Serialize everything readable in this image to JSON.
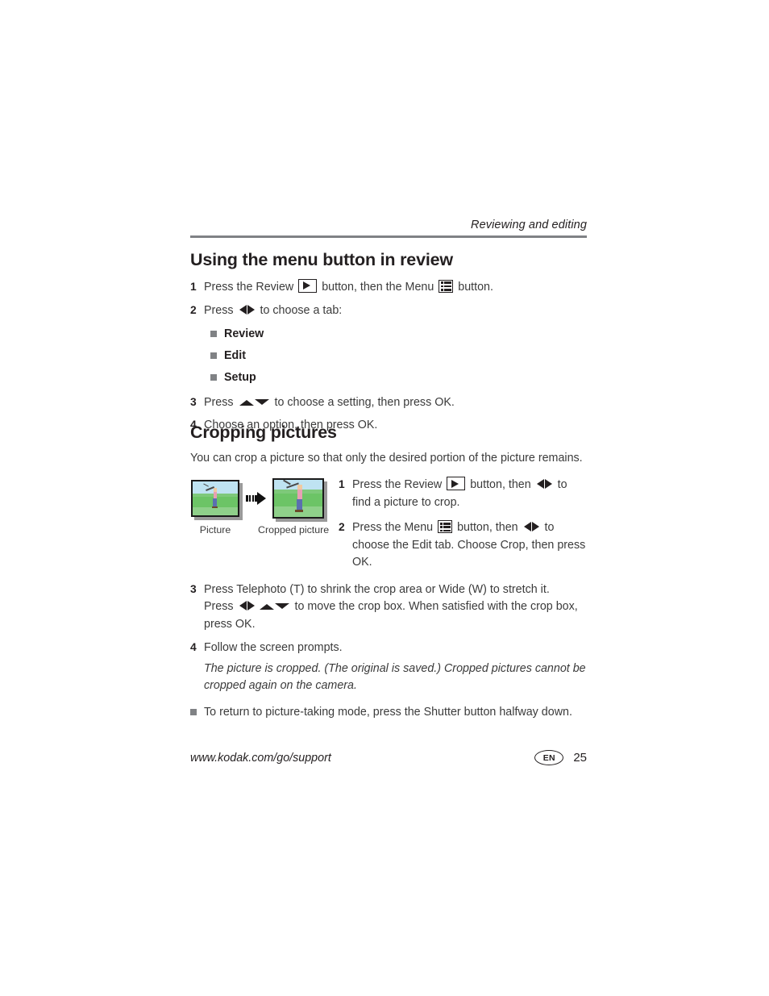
{
  "header": {
    "title": "Reviewing and editing"
  },
  "sections": [
    {
      "heading": "Using the menu button in review",
      "steps": [
        {
          "num": "1",
          "parts": [
            "Press the Review ",
            "review-icon",
            " button, then the Menu ",
            "menu-icon",
            " button."
          ]
        },
        {
          "num": "2",
          "parts": [
            "Press ",
            "left-right-arrows",
            " to choose a tab:"
          ]
        },
        {
          "num": "3",
          "parts": [
            "Press ",
            "up-down-arrows",
            " to choose a setting, then press OK."
          ]
        },
        {
          "num": "4",
          "parts": [
            "Choose an option, then press OK."
          ]
        }
      ],
      "tabs": [
        "Review",
        "Edit",
        "Setup"
      ]
    },
    {
      "heading": "Cropping pictures",
      "intro": "You can crop a picture so that only the desired portion of the picture remains.",
      "figure": {
        "caption_left": "Picture",
        "caption_right": "Cropped picture",
        "arrow": "right-block-arrow"
      },
      "steps": [
        {
          "num": "1",
          "parts": [
            "Press the Review ",
            "review-icon",
            " button, then ",
            "left-right-arrows",
            " to find a picture to crop."
          ]
        },
        {
          "num": "2",
          "parts": [
            "Press the Menu ",
            "menu-icon",
            " button, then ",
            "left-right-arrows",
            " to choose the Edit tab. Choose Crop, then press OK."
          ]
        },
        {
          "num": "3",
          "line1": "Press Telephoto (T) to shrink the crop area or Wide (W) to stretch it.",
          "line2_a": "Press ",
          "line2_b": " to move the crop box. When satisfied with the crop box, press OK."
        },
        {
          "num": "4",
          "line1": "Follow the screen prompts.",
          "note": "The picture is cropped. (The original is saved.) Cropped pictures cannot be cropped again on the camera."
        }
      ],
      "final_bullet": "To return to picture-taking mode, press the Shutter button halfway down."
    }
  ],
  "step1_text": {
    "a": "Press the Review ",
    "b": " button, then the Menu ",
    "c": " button."
  },
  "step2_text": {
    "a": "Press ",
    "b": " to choose a tab:"
  },
  "step3_text": {
    "a": "Press ",
    "b": " to choose a setting, then press OK."
  },
  "step4_text": "Choose an option, then press OK.",
  "crop_step1": {
    "a": "Press the Review ",
    "b": " button, then ",
    "c": " to find a picture to crop."
  },
  "crop_step2": {
    "a": "Press the Menu ",
    "b": " button, then ",
    "c": " to choose the Edit tab. Choose Crop, then press OK."
  },
  "crop_step3": {
    "line1": "Press Telephoto (T) to shrink the crop area or Wide (W) to stretch it.",
    "a": "Press ",
    "b": " to move the crop box. When satisfied with the crop box, press OK."
  },
  "crop_step4": {
    "line1": "Follow the screen prompts.",
    "note": "The picture is cropped. (The original is saved.) Cropped pictures cannot be cropped again on the camera."
  },
  "footer": {
    "url": "www.kodak.com/go/support",
    "language": "EN",
    "page_number": "25"
  },
  "colors": {
    "rule": "#808285",
    "bullet": "#808285",
    "text": "#3b3b3b",
    "heading": "#231f20",
    "sky": "#bfe3f2",
    "grass_light": "#8fd08a",
    "grass_dark": "#5cba55",
    "shirt": "#e8a0b4",
    "pants": "#5b6fb0"
  }
}
